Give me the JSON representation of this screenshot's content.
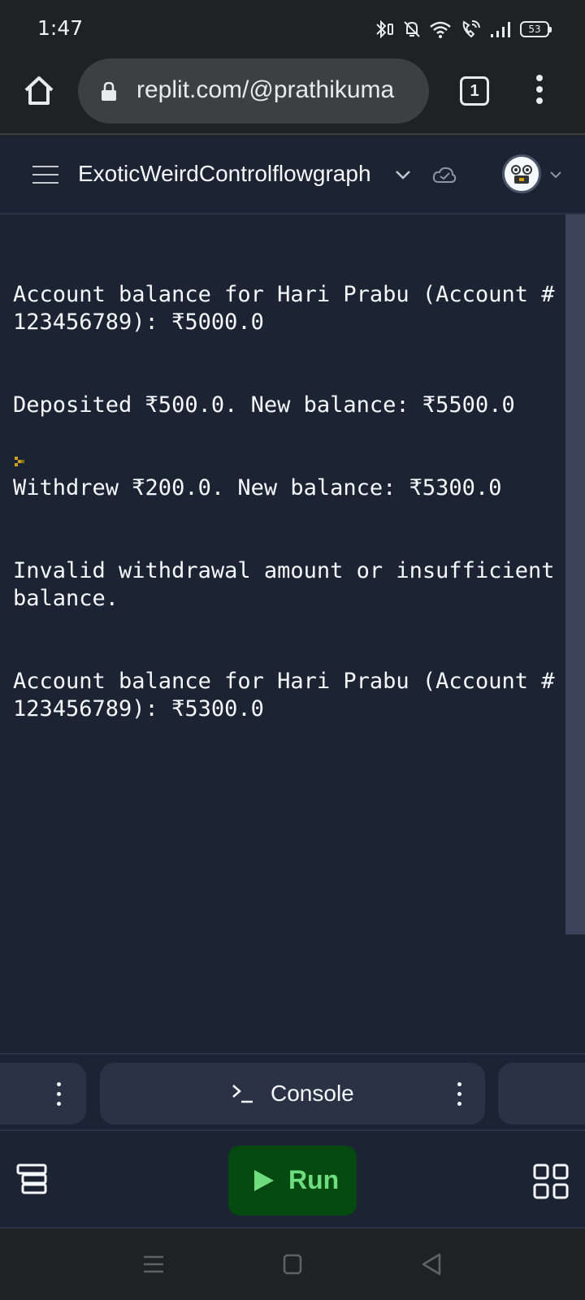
{
  "status_bar": {
    "time": "1:47",
    "battery": "53",
    "icons": [
      "bluetooth-vibrate-icon",
      "bell-off-icon",
      "wifi-icon",
      "wifi-call-icon",
      "signal-icon",
      "battery-icon"
    ]
  },
  "browser": {
    "url": "replit.com/@prathikuma",
    "tab_count": "1"
  },
  "repl": {
    "name": "ExoticWeirdControlflowgraph"
  },
  "console": {
    "lines": [
      "Account balance for Hari Prabu (Account #123456789): ₹5000.0",
      "Deposited ₹500.0. New balance: ₹5500.0",
      "Withdrew ₹200.0. New balance: ₹5300.0",
      "Invalid withdrawal amount or insufficient balance.",
      "Account balance for Hari Prabu (Account #123456789): ₹5300.0"
    ]
  },
  "tabs": {
    "console_label": "Console"
  },
  "toolbar": {
    "run_label": "Run"
  },
  "colors": {
    "background": "#1c2333",
    "run_button": "#044a10",
    "run_text": "#6fdc7f",
    "prompt": "#c9a227"
  }
}
